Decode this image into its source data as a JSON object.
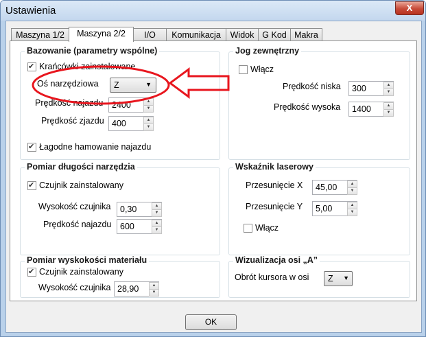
{
  "window": {
    "title": "Ustawienia",
    "close_label": "X"
  },
  "tabs": [
    "Maszyna 1/2",
    "Maszyna 2/2",
    "I/O",
    "Komunikacja",
    "Widok",
    "G Kod",
    "Makra"
  ],
  "homing": {
    "title": "Bazowanie (parametry wspólne)",
    "endstops_label": "Krańcówki zainstalowane",
    "endstops_checked": true,
    "tool_axis_label": "Oś narzędziowa",
    "tool_axis_value": "Z",
    "approach_speed_label": "Prędkość najazdu",
    "approach_speed_value": "2400",
    "leave_speed_label": "Prędkość zjazdu",
    "leave_speed_value": "400",
    "soft_brake_label": "Łagodne hamowanie najazdu",
    "soft_brake_checked": true
  },
  "jog": {
    "title": "Jog zewnętrzny",
    "enable_label": "Włącz",
    "enable_checked": false,
    "low_speed_label": "Prędkość niska",
    "low_speed_value": "300",
    "high_speed_label": "Prędkość wysoka",
    "high_speed_value": "1400"
  },
  "tool_length": {
    "title": "Pomiar długości narzędzia",
    "sensor_label": "Czujnik zainstalowany",
    "sensor_checked": true,
    "sensor_height_label": "Wysokość czujnika",
    "sensor_height_value": "0,30",
    "approach_speed_label": "Prędkość najazdu",
    "approach_speed_value": "600"
  },
  "laser": {
    "title": "Wskaźnik laserowy",
    "offset_x_label": "Przesunięcie X",
    "offset_x_value": "45,00",
    "offset_y_label": "Przesunięcie Y",
    "offset_y_value": "5,00",
    "enable_label": "Włącz",
    "enable_checked": false
  },
  "material_height": {
    "title": "Pomiar wyskokości materiału",
    "sensor_label": "Czujnik zainstalowany",
    "sensor_checked": true,
    "sensor_height_label": "Wysokość czujnika",
    "sensor_height_value": "28,90"
  },
  "a_axis": {
    "title": "Wizualizacja osi „A”",
    "cursor_rotation_label": "Obrót kursora w osi",
    "cursor_rotation_value": "Z"
  },
  "footer": {
    "ok_label": "OK"
  },
  "annotation": {
    "color": "#e8161e"
  }
}
